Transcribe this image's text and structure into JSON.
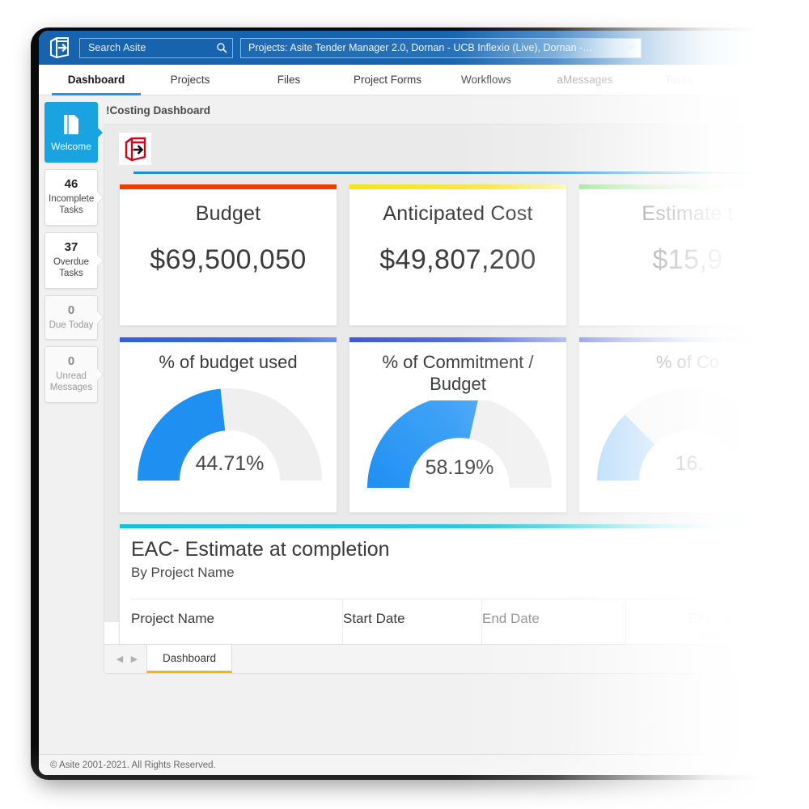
{
  "topbar": {
    "logo_icon": "asite-cube-logo-icon",
    "search": {
      "placeholder": "Search Asite",
      "value": "",
      "icon": "search-icon"
    },
    "project_selector": {
      "value": "Projects: Asite Tender Manager 2.0, Dornan - UCB Inflexio (Live), Dornan -…",
      "icon": "chevron-down-icon"
    },
    "accent_color": "#1763ae"
  },
  "nav": {
    "tabs": [
      {
        "label": "Dashboard",
        "active": true
      },
      {
        "label": "Projects",
        "active": false
      },
      {
        "label": "Files",
        "active": false
      },
      {
        "label": "Project Forms",
        "active": false
      },
      {
        "label": "Workflows",
        "active": false
      },
      {
        "label": "aMessages",
        "active": false
      },
      {
        "label": "Tasks",
        "active": false
      }
    ],
    "active_underline_color": "#2196e8"
  },
  "sidebar": {
    "items": [
      {
        "count": "",
        "label": "Welcome",
        "active": true,
        "icon": "page-fold-icon"
      },
      {
        "count": "46",
        "label": "Incomplete Tasks",
        "active": false
      },
      {
        "count": "37",
        "label": "Overdue Tasks",
        "active": false
      },
      {
        "count": "0",
        "label": "Due Today",
        "active": false
      },
      {
        "count": "0",
        "label": "Unread Messages",
        "active": false
      }
    ],
    "active_color": "#19a3e0"
  },
  "dashboard": {
    "title": "!Costing Dashboard",
    "sheet_logo_icon": "asite-cube-logo-red-icon",
    "sheet_tab": {
      "label": "Dashboard",
      "underline_color": "#f2b705"
    },
    "tab_nav_prev_icon": "chevron-left-icon",
    "tab_nav_next_icon": "chevron-right-icon"
  },
  "kpi_cards": [
    {
      "title": "Budget",
      "value": "$69,500,050",
      "stripe_color": "#f03c02"
    },
    {
      "title": "Anticipated Cost",
      "value": "$49,807,200",
      "stripe_color": "#f7e416"
    },
    {
      "title": "Estimate t",
      "value": "$15,9",
      "stripe_color": "#8ede7e",
      "truncated": true
    }
  ],
  "gauge_cards": [
    {
      "title": "% of budget used",
      "value_label": "44.71%",
      "percent": 44.71,
      "stripe_color": "#2f5fe0",
      "arc_color": "#1f8ff2"
    },
    {
      "title": "% of Commitment / Budget",
      "value_label": "58.19%",
      "percent": 58.19,
      "stripe_color": "#3f57dd",
      "arc_color": "#1f8ff2"
    },
    {
      "title": "% of Co",
      "value_label": "16.",
      "percent": 16.0,
      "stripe_color": "#6f7fe8",
      "arc_color": "#9ccdf7",
      "truncated": true
    }
  ],
  "eac": {
    "title": "EAC- Estimate at completion",
    "subtitle": "By Project Name",
    "stripe_color": "#0fc4d6",
    "columns": [
      "Project Name",
      "Start Date",
      "End Date",
      "EAC- Es"
    ],
    "column_4_line2": "com",
    "rows": []
  },
  "chart_data": {
    "type": "table",
    "title": "EAC- Estimate at completion",
    "subtitle": "By Project Name",
    "columns": [
      "Project Name",
      "Start Date",
      "End Date",
      "EAC- Estimate at completion"
    ],
    "rows": [],
    "gauges": [
      {
        "label": "% of budget used",
        "value": 44.71,
        "unit": "%",
        "max": 100
      },
      {
        "label": "% of Commitment / Budget",
        "value": 58.19,
        "unit": "%",
        "max": 100
      },
      {
        "label": "% of Co",
        "value": 16.0,
        "unit": "%",
        "max": 100
      }
    ],
    "kpis": [
      {
        "label": "Budget",
        "value": 69500050,
        "display": "$69,500,050"
      },
      {
        "label": "Anticipated Cost",
        "value": 49807200,
        "display": "$49,807,200"
      },
      {
        "label": "Estimate t",
        "value": null,
        "display": "$15,9"
      }
    ]
  },
  "footer": {
    "text": "© Asite 2001-2021. All Rights Reserved."
  }
}
